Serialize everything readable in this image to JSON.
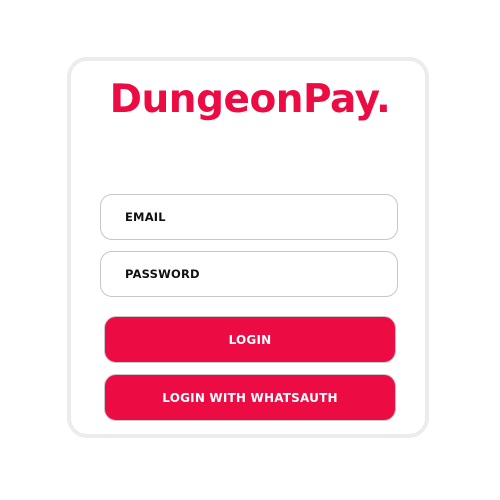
{
  "brand": {
    "name": "DungeonPay.",
    "color": "#ec0b43"
  },
  "form": {
    "email_placeholder": "EMAIL",
    "password_placeholder": "PASSWORD",
    "login_label": "LOGIN",
    "whatsauth_label": "LOGIN WITH WHATSAUTH"
  },
  "colors": {
    "accent": "#ec0b43",
    "card_border": "#ececec",
    "field_border": "#c7c7c7"
  }
}
